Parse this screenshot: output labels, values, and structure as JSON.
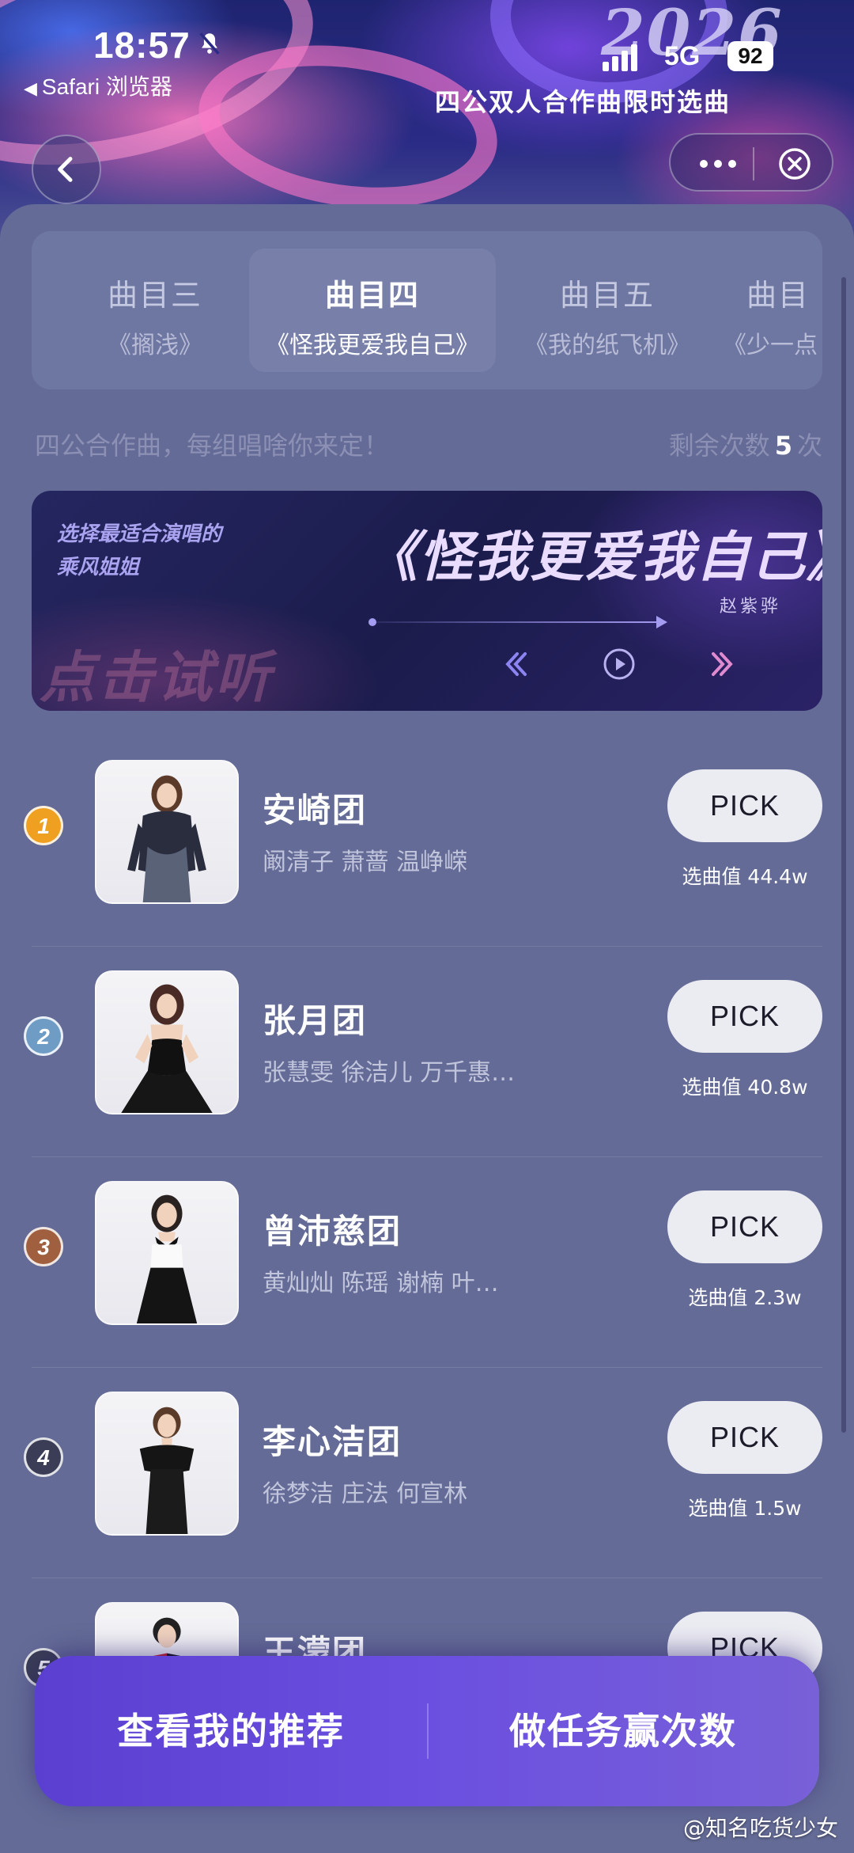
{
  "status_bar": {
    "time": "18:57",
    "back_app": "Safari 浏览器",
    "network": "5G",
    "battery": "92"
  },
  "hero": {
    "year": "2026",
    "subtitle": "四公双人合作曲限时选曲"
  },
  "tabs": [
    {
      "title": "曲目三",
      "song": "《搁浅》",
      "active": false
    },
    {
      "title": "曲目四",
      "song": "《怪我更爱我自己》",
      "active": true
    },
    {
      "title": "曲目五",
      "song": "《我的纸飞机》",
      "active": false
    },
    {
      "title": "曲目",
      "song": "《少一点",
      "active": false
    }
  ],
  "hint": {
    "text": "四公合作曲，每组唱啥你来定！",
    "remaining_label": "剩余次数",
    "remaining_count": "5",
    "remaining_unit": "次"
  },
  "banner": {
    "tagline_1": "选择最适合演唱的",
    "tagline_2": "乘风姐姐",
    "song": "《怪我更爱我自己》",
    "singer": "赵紫骅",
    "try_listen": "点击试听"
  },
  "ranking": [
    {
      "rank": "1",
      "group": "安崎团",
      "members": "阚清子 萧蔷 温峥嵘",
      "pick_label": "PICK",
      "votes": "选曲值 44.4w",
      "rank_color": "#f0a020"
    },
    {
      "rank": "2",
      "group": "张月团",
      "members": "张慧雯 徐洁儿 万千惠…",
      "pick_label": "PICK",
      "votes": "选曲值 40.8w",
      "rank_color": "#6f9cc4"
    },
    {
      "rank": "3",
      "group": "曾沛慈团",
      "members": "黄灿灿 陈瑶 谢楠 叶…",
      "pick_label": "PICK",
      "votes": "选曲值 2.3w",
      "rank_color": "#a0603f"
    },
    {
      "rank": "4",
      "group": "李心洁团",
      "members": "徐梦洁 庄法 何宣林",
      "pick_label": "PICK",
      "votes": "选曲值 1.5w",
      "rank_color": "#3a3d55"
    },
    {
      "rank": "5",
      "group": "王濛团",
      "members": "",
      "pick_label": "PICK",
      "votes": "",
      "rank_color": "#3a3d55"
    }
  ],
  "actions": {
    "recommend": "查看我的推荐",
    "tasks": "做任务赢次数"
  },
  "watermark": "@知名吃货少女"
}
